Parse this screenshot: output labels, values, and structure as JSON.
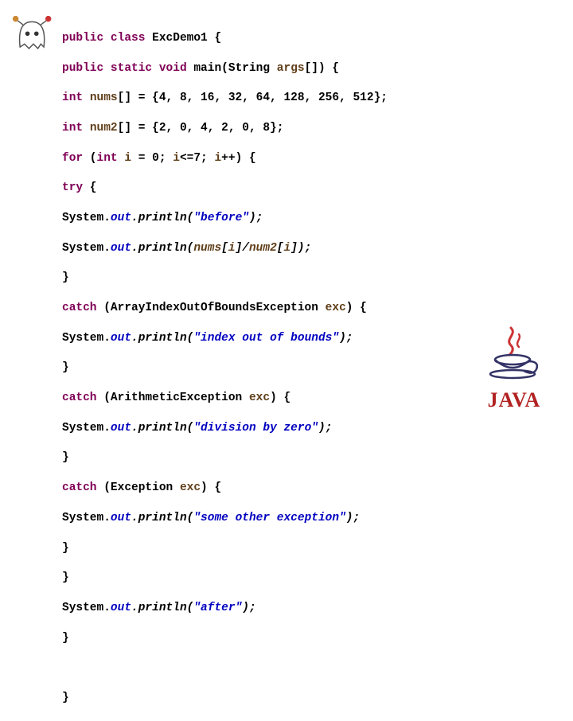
{
  "code": {
    "l1": {
      "k1": "public",
      "k2": "class",
      "cls": "ExcDemo1",
      "brace": "{"
    },
    "l2": {
      "k1": "public",
      "k2": "static",
      "k3": "void",
      "m": "main",
      "p1": "(String ",
      "arg": "args",
      "p2": "[]) {"
    },
    "l3": {
      "k1": "int",
      "id": "nums",
      "rest": "[] = {4, 8, 16, 32, 64, 128, 256, 512};"
    },
    "l4": {
      "k1": "int",
      "id": "num2",
      "rest": "[] = {2, 0, 4, 2, 0, 8};"
    },
    "l5": {
      "k1": "for",
      "p1": " (",
      "k2": "int",
      "sp": " ",
      "i": "i",
      "p2": " = 0; ",
      "i2": "i",
      "p3": "<=7; ",
      "i3": "i",
      "p4": "++) {"
    },
    "l6": {
      "k1": "try",
      "brace": " {"
    },
    "l7": {
      "sys": "System.",
      "out": "out",
      "dot": ".",
      "m": "println",
      "p1": "(",
      "s": "\"before\"",
      "p2": ");"
    },
    "l8": {
      "sys": "System.",
      "out": "out",
      "dot": ".",
      "m": "println",
      "p1": "(",
      "a": "nums",
      "b": "[",
      "i1": "i",
      "c": "]/",
      "d": "num2",
      "e": "[",
      "i2": "i",
      "f": "]);"
    },
    "l9": {
      "brace": "}"
    },
    "l10": {
      "k1": "catch",
      "p1": " (ArrayIndexOutOfBoundsException ",
      "exc": "exc",
      "p2": ") {"
    },
    "l11": {
      "sys": "System.",
      "out": "out",
      "dot": ".",
      "m": "println",
      "p1": "(",
      "s": "\"index out of bounds\"",
      "p2": ");"
    },
    "l12": {
      "brace": "}"
    },
    "l13": {
      "k1": "catch",
      "p1": " (ArithmeticException ",
      "exc": "exc",
      "p2": ") {"
    },
    "l14": {
      "sys": "System.",
      "out": "out",
      "dot": ".",
      "m": "println",
      "p1": "(",
      "s": "\"division by zero\"",
      "p2": ");"
    },
    "l15": {
      "brace": "}"
    },
    "l16": {
      "k1": "catch",
      "p1": " (Exception ",
      "exc": "exc",
      "p2": ") {"
    },
    "l17": {
      "sys": "System.",
      "out": "out",
      "dot": ".",
      "m": "println",
      "p1": "(",
      "s": "\"some other exception\"",
      "p2": ");"
    },
    "l18": {
      "brace": "}"
    },
    "l19": {
      "brace": "}"
    },
    "l20": {
      "sys": "System.",
      "out": "out",
      "dot": ".",
      "m": "println",
      "p1": "(",
      "s": "\"after\"",
      "p2": ");"
    },
    "l21": {
      "brace": "}"
    },
    "l22": {
      "blank": ""
    },
    "l23": {
      "brace": "}"
    }
  },
  "logo": {
    "text": "JAVA"
  }
}
